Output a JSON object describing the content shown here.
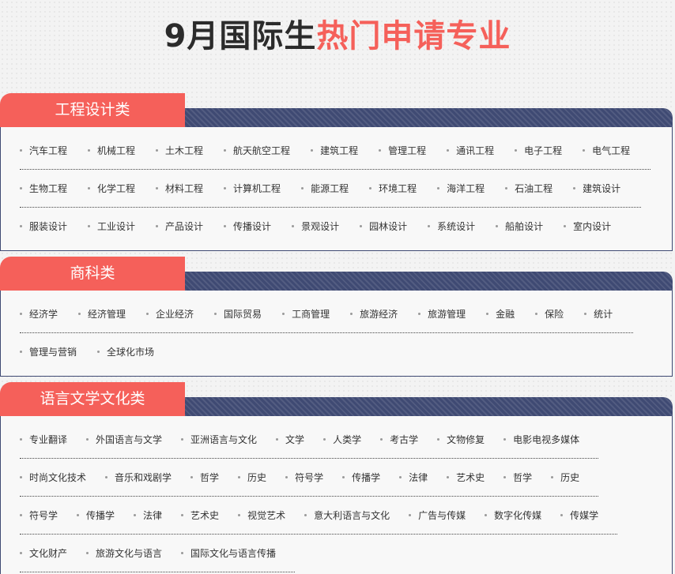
{
  "title": {
    "part1": "9月国际生",
    "part2": "热门申请专业"
  },
  "sections": [
    {
      "name": "工程设计类",
      "rows": [
        [
          "汽车工程",
          "机械工程",
          "土木工程",
          "航天航空工程",
          "建筑工程",
          "管理工程",
          "通讯工程",
          "电子工程",
          "电气工程"
        ],
        [
          "生物工程",
          "化学工程",
          "材料工程",
          "计算机工程",
          "能源工程",
          "环境工程",
          "海洋工程",
          "石油工程",
          "建筑设计"
        ],
        [
          "服装设计",
          "工业设计",
          "产品设计",
          "传播设计",
          "景观设计",
          "园林设计",
          "系统设计",
          "船舶设计",
          "室内设计"
        ]
      ]
    },
    {
      "name": "商科类",
      "rows": [
        [
          "经济学",
          "经济管理",
          "企业经济",
          "国际贸易",
          "工商管理",
          "旅游经济",
          "旅游管理",
          "金融",
          "保险",
          "统计"
        ],
        [
          "管理与营销",
          "全球化市场"
        ]
      ]
    },
    {
      "name": "语言文学文化类",
      "rows": [
        [
          "专业翻译",
          "外国语言与文学",
          "亚洲语言与文化",
          "文学",
          "人类学",
          "考古学",
          "文物修复",
          "电影电视多媒体"
        ],
        [
          "时尚文化技术",
          "音乐和戏剧学",
          "哲学",
          "历史",
          "符号学",
          "传播学",
          "法律",
          "艺术史",
          "哲学",
          "历史"
        ],
        [
          "符号学",
          "传播学",
          "法律",
          "艺术史",
          "视觉艺术",
          "意大利语言与文化",
          "广告与传媒",
          "数字化传媒",
          "传媒学"
        ],
        [
          "文化财产",
          "旅游文化与语言",
          "国际文化与语言传播"
        ]
      ]
    }
  ]
}
